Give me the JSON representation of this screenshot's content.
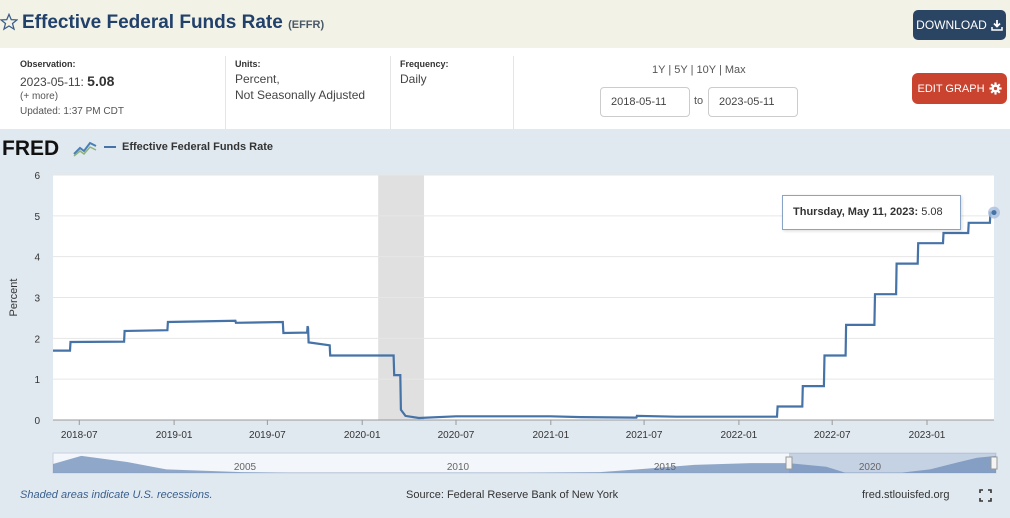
{
  "header": {
    "title": "Effective Federal Funds Rate",
    "code": "(EFFR)",
    "download_label": "DOWNLOAD"
  },
  "meta": {
    "observation_label": "Observation:",
    "observation_date": "2023-05-11:",
    "observation_value": "5.08",
    "more_link": "(+ more)",
    "updated": "Updated: 1:37 PM CDT",
    "units_label": "Units:",
    "units_line1": "Percent,",
    "units_line2": "Not Seasonally Adjusted",
    "frequency_label": "Frequency:",
    "frequency_value": "Daily"
  },
  "controls": {
    "range_1y": "1Y",
    "range_5y": "5Y",
    "range_10y": "10Y",
    "range_max": "Max",
    "sep": "|",
    "start_date": "2018-05-11",
    "to_label": "to",
    "end_date": "2023-05-11",
    "edit_label": "EDIT GRAPH"
  },
  "legend": {
    "logo": "FRED",
    "series": "Effective Federal Funds Rate"
  },
  "tooltip": {
    "date": "Thursday, May 11, 2023:",
    "value": "5.08"
  },
  "footer": {
    "recession_note": "Shaded areas indicate U.S. recessions.",
    "source": "Source: Federal Reserve Bank of New York",
    "site": "fred.stlouisfed.org"
  },
  "colors": {
    "line": "#4572a7",
    "recession": "#e0e0e0",
    "navigator_fill": "#7c99bf",
    "download_btn": "#2a4463",
    "edit_btn": "#c9432f"
  },
  "chart_data": {
    "type": "line",
    "ylabel": "Percent",
    "ylim": [
      0,
      6
    ],
    "yticks": [
      0,
      1,
      2,
      3,
      4,
      5,
      6
    ],
    "xlim": [
      "2018-05-11",
      "2023-05-11"
    ],
    "xticks": [
      "2018-07",
      "2019-01",
      "2019-07",
      "2020-01",
      "2020-07",
      "2021-01",
      "2021-07",
      "2022-01",
      "2022-07",
      "2023-01"
    ],
    "recessions": [
      [
        "2020-02-01",
        "2020-04-30"
      ]
    ],
    "series": [
      {
        "name": "Effective Federal Funds Rate",
        "points": [
          [
            "2018-05-11",
            1.7
          ],
          [
            "2018-06-13",
            1.7
          ],
          [
            "2018-06-14",
            1.91
          ],
          [
            "2018-09-26",
            1.92
          ],
          [
            "2018-09-27",
            2.18
          ],
          [
            "2018-12-19",
            2.2
          ],
          [
            "2018-12-20",
            2.4
          ],
          [
            "2019-04-30",
            2.43
          ],
          [
            "2019-05-01",
            2.38
          ],
          [
            "2019-07-31",
            2.4
          ],
          [
            "2019-08-01",
            2.13
          ],
          [
            "2019-09-16",
            2.14
          ],
          [
            "2019-09-17",
            2.3
          ],
          [
            "2019-09-18",
            2.25
          ],
          [
            "2019-09-19",
            1.9
          ],
          [
            "2019-10-30",
            1.83
          ],
          [
            "2019-10-31",
            1.58
          ],
          [
            "2020-03-02",
            1.58
          ],
          [
            "2020-03-03",
            1.1
          ],
          [
            "2020-03-15",
            1.1
          ],
          [
            "2020-03-16",
            0.25
          ],
          [
            "2020-03-25",
            0.1
          ],
          [
            "2020-04-20",
            0.05
          ],
          [
            "2020-07-01",
            0.09
          ],
          [
            "2020-10-01",
            0.09
          ],
          [
            "2021-01-01",
            0.09
          ],
          [
            "2021-03-01",
            0.07
          ],
          [
            "2021-06-16",
            0.06
          ],
          [
            "2021-06-17",
            0.1
          ],
          [
            "2021-09-01",
            0.08
          ],
          [
            "2022-01-01",
            0.08
          ],
          [
            "2022-03-16",
            0.08
          ],
          [
            "2022-03-17",
            0.33
          ],
          [
            "2022-05-04",
            0.33
          ],
          [
            "2022-05-05",
            0.83
          ],
          [
            "2022-06-15",
            0.83
          ],
          [
            "2022-06-16",
            1.58
          ],
          [
            "2022-07-27",
            1.58
          ],
          [
            "2022-07-28",
            2.33
          ],
          [
            "2022-09-21",
            2.33
          ],
          [
            "2022-09-22",
            3.08
          ],
          [
            "2022-11-02",
            3.08
          ],
          [
            "2022-11-03",
            3.83
          ],
          [
            "2022-12-14",
            3.83
          ],
          [
            "2022-12-15",
            4.33
          ],
          [
            "2023-02-01",
            4.33
          ],
          [
            "2023-02-02",
            4.58
          ],
          [
            "2023-03-22",
            4.58
          ],
          [
            "2023-03-23",
            4.83
          ],
          [
            "2023-05-03",
            4.83
          ],
          [
            "2023-05-04",
            5.08
          ],
          [
            "2023-05-11",
            5.08
          ]
        ]
      }
    ],
    "navigator": {
      "labels": [
        "2005",
        "2010",
        "2015",
        "2020"
      ]
    }
  }
}
